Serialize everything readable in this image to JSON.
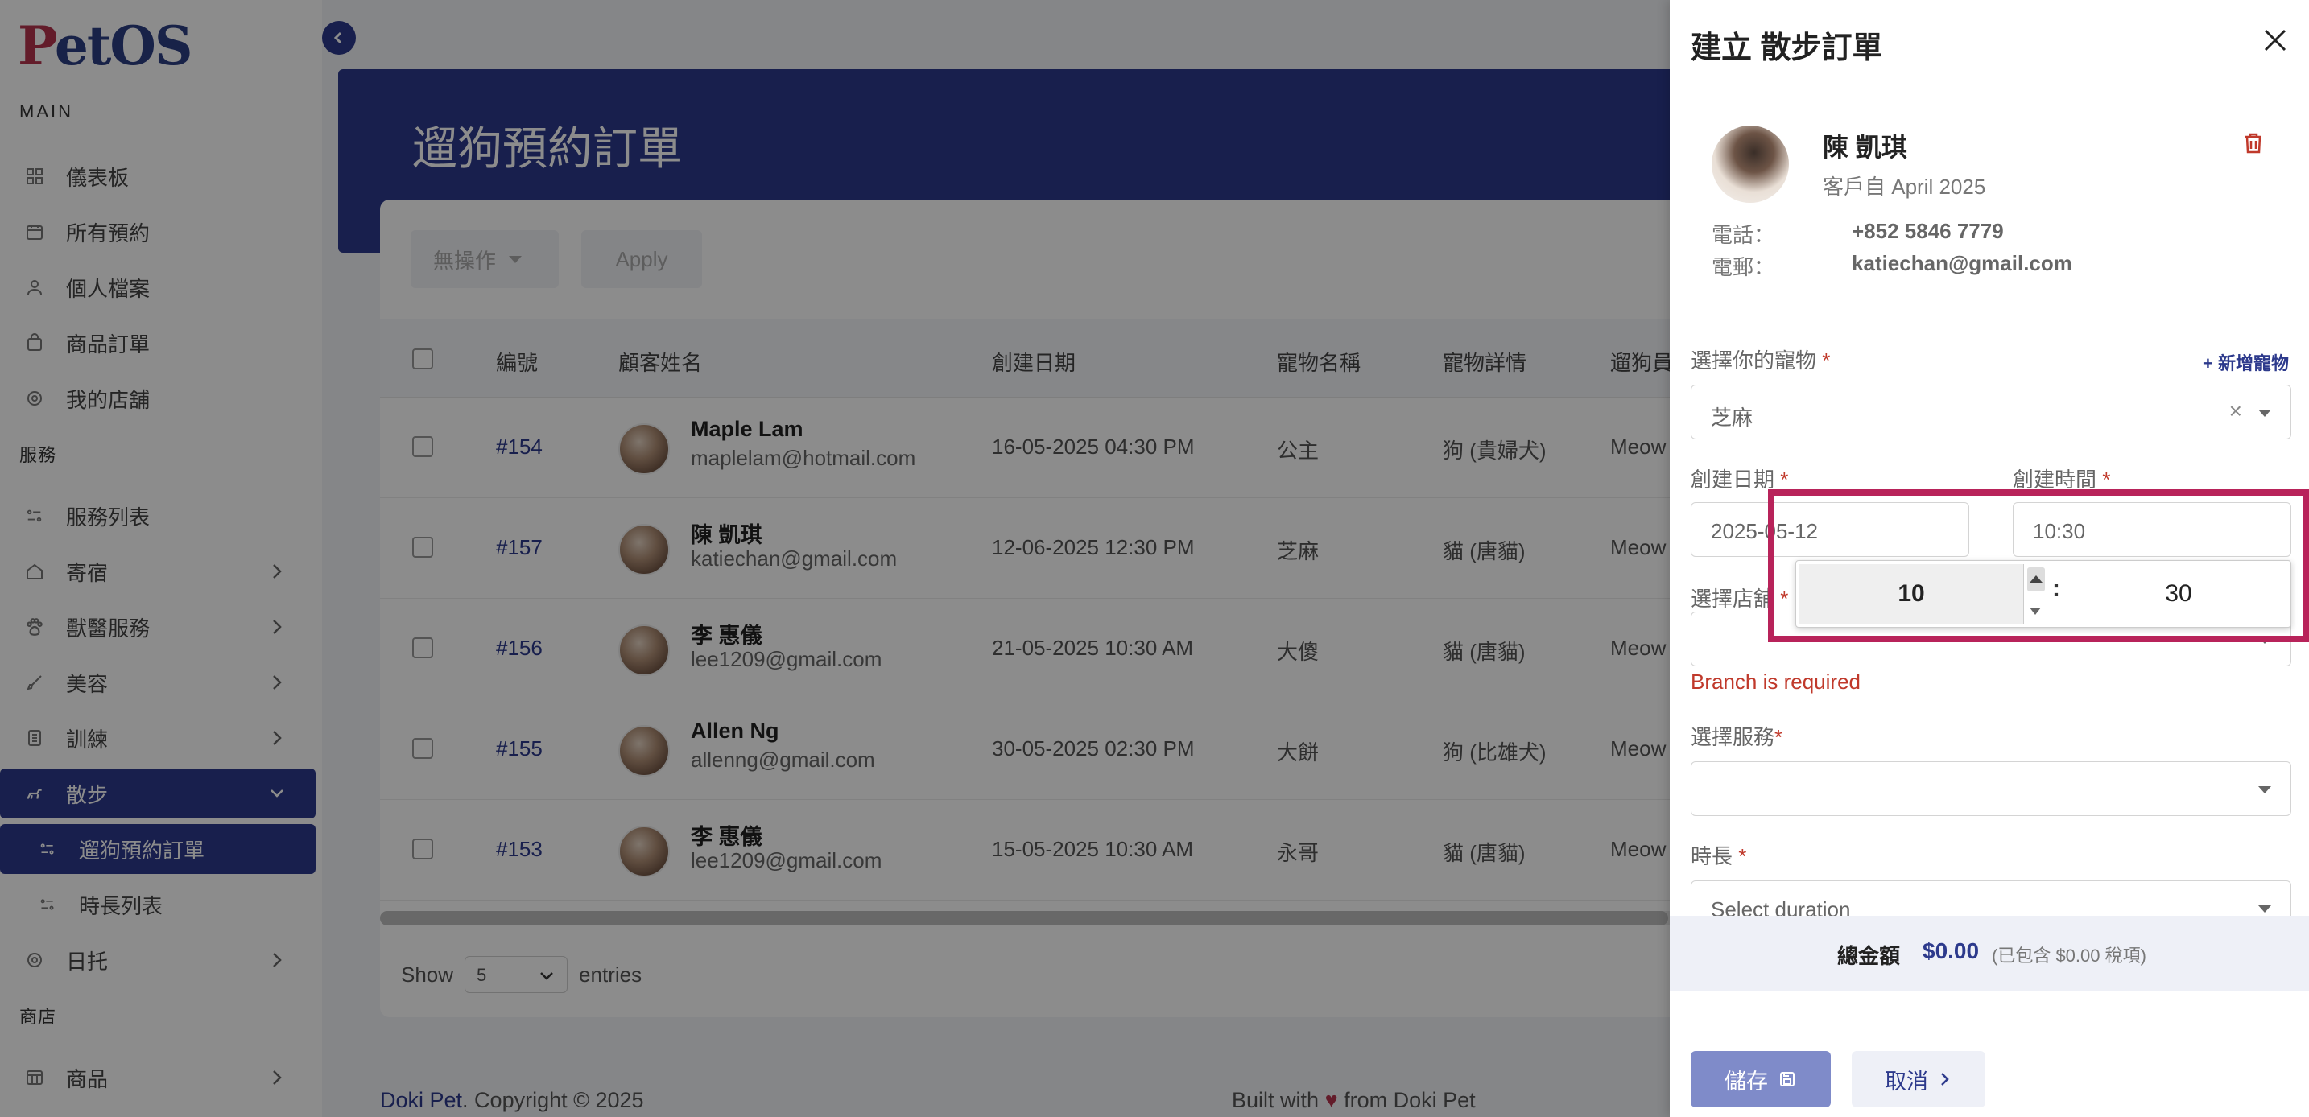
{
  "app": {
    "logo": "PetOS"
  },
  "sidebar": {
    "section_main": "MAIN",
    "section_services": "服務",
    "section_shop": "商店",
    "items": [
      {
        "label": "儀表板",
        "icon": "dashboard-icon"
      },
      {
        "label": "所有預約",
        "icon": "calendar-icon"
      },
      {
        "label": "個人檔案",
        "icon": "user-icon"
      },
      {
        "label": "商品訂單",
        "icon": "bag-icon"
      },
      {
        "label": "我的店舖",
        "icon": "store-icon"
      },
      {
        "label": "服務列表",
        "icon": "list-icon"
      },
      {
        "label": "寄宿",
        "icon": "home-icon"
      },
      {
        "label": "獸醫服務",
        "icon": "paw-icon"
      },
      {
        "label": "美容",
        "icon": "brush-icon"
      },
      {
        "label": "訓練",
        "icon": "training-icon"
      },
      {
        "label": "散步",
        "icon": "dog-walk-icon"
      },
      {
        "label": "遛狗預約訂單",
        "icon": "list-icon"
      },
      {
        "label": "時長列表",
        "icon": "list-icon"
      },
      {
        "label": "日托",
        "icon": "daycare-icon"
      },
      {
        "label": "商品",
        "icon": "shop-icon"
      }
    ]
  },
  "page": {
    "title": "遛狗預約訂單"
  },
  "toolbar": {
    "bulk_action": "無操作",
    "apply": "Apply"
  },
  "table": {
    "headers": [
      "編號",
      "顧客姓名",
      "創建日期",
      "寵物名稱",
      "寵物詳情",
      "遛狗員"
    ],
    "rows": [
      {
        "id": "#154",
        "name": "Maple Lam",
        "email": "maplelam@hotmail.com",
        "date": "16-05-2025 04:30 PM",
        "pet": "公主",
        "detail": "狗 (貴婦犬)",
        "walker": "Meow"
      },
      {
        "id": "#157",
        "name": "陳 凱琪",
        "email": "katiechan@gmail.com",
        "date": "12-06-2025 12:30 PM",
        "pet": "芝麻",
        "detail": "貓 (唐貓)",
        "walker": "Meow"
      },
      {
        "id": "#156",
        "name": "李 惠儀",
        "email": "lee1209@gmail.com",
        "date": "21-05-2025 10:30 AM",
        "pet": "大傻",
        "detail": "貓 (唐貓)",
        "walker": "Meow"
      },
      {
        "id": "#155",
        "name": "Allen Ng",
        "email": "allenng@gmail.com",
        "date": "30-05-2025 02:30 PM",
        "pet": "大餅",
        "detail": "狗 (比雄犬)",
        "walker": "Meow"
      },
      {
        "id": "#153",
        "name": "李 惠儀",
        "email": "lee1209@gmail.com",
        "date": "15-05-2025 10:30 AM",
        "pet": "永哥",
        "detail": "貓 (唐貓)",
        "walker": "Meow"
      }
    ]
  },
  "pagination": {
    "show": "Show",
    "entries_value": "5",
    "entries": "entries"
  },
  "footer": {
    "brand": "Doki Pet",
    "copyright": ". Copyright © 2025",
    "built_prefix": "Built with",
    "built_suffix": "from Doki Pet"
  },
  "drawer": {
    "title": "建立 散步訂單",
    "customer": {
      "name": "陳 凱琪",
      "since": "客戶自 April 2025",
      "phone_label": "電話：",
      "phone": "+852 5846 7779",
      "email_label": "電郵：",
      "email": "katiechan@gmail.com"
    },
    "pet_label": "選擇你的寵物",
    "add_pet": "+ 新增寵物",
    "pet_value": "芝麻",
    "date_label": "創建日期",
    "date_value": "2025-05-12",
    "time_label": "創建時間",
    "time_value": "10:30",
    "time_hour": "10",
    "time_minute": "30",
    "branch_label": "選擇店舖",
    "branch_error": "Branch is required",
    "service_label": "選擇服務",
    "duration_label": "時長",
    "duration_placeholder": "Select duration",
    "total_label": "總金額",
    "total_value": "$0.00",
    "total_tax": "(已包含 $0.00 稅項)",
    "save": "儲存",
    "cancel": "取消",
    "required_mark": "*"
  },
  "colors": {
    "primary": "#2d3a8c",
    "accent": "#b5334e",
    "highlight": "#b8235a",
    "error": "#c0392b"
  }
}
